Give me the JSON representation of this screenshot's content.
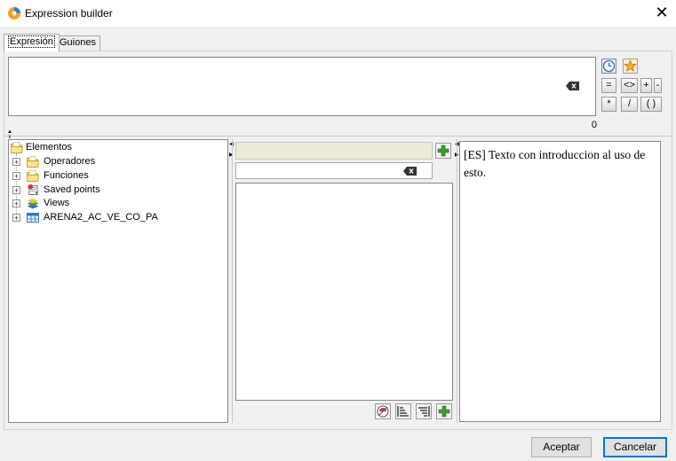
{
  "window": {
    "title": "Expression builder",
    "close_glyph": "✕"
  },
  "tabs": [
    {
      "label": "Expresión",
      "active": true
    },
    {
      "label": "Guiones",
      "active": false
    }
  ],
  "expression": {
    "value": "",
    "char_count": "0"
  },
  "operators": [
    {
      "label": "=",
      "name": "equals-button"
    },
    {
      "label": "<>",
      "name": "not-equals-button"
    },
    {
      "label": "+",
      "name": "plus-button"
    },
    {
      "label": "-",
      "name": "minus-button"
    },
    {
      "label": "*",
      "name": "multiply-button"
    },
    {
      "label": "/",
      "name": "divide-button"
    },
    {
      "label": "( )",
      "name": "parentheses-button"
    }
  ],
  "tree": {
    "root": {
      "label": "Elementos",
      "icon": "folder-icon"
    },
    "items": [
      {
        "label": "Operadores",
        "icon": "folder-icon"
      },
      {
        "label": "Funciones",
        "icon": "folder-icon"
      },
      {
        "label": "Saved points",
        "icon": "saved-points-icon"
      },
      {
        "label": "Views",
        "icon": "layers-icon"
      },
      {
        "label": "ARENA2_AC_VE_CO_PA",
        "icon": "table-icon"
      }
    ]
  },
  "search": {
    "value": ""
  },
  "description": {
    "text": "[ES] Texto con introduccion al uso de esto."
  },
  "footer": {
    "ok_label": "Aceptar",
    "cancel_label": "Cancelar"
  },
  "colors": {
    "accent": "#0078d7",
    "header_bar": "#ece9d8",
    "add_green": "#3a9b2e"
  }
}
